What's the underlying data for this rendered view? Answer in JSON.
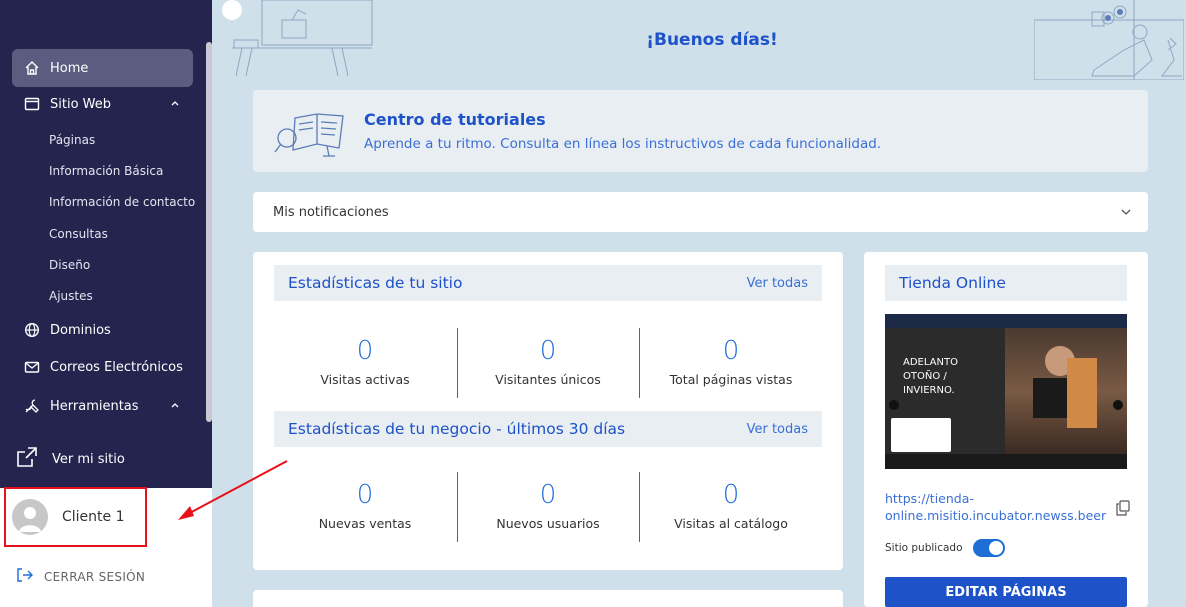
{
  "sidebar": {
    "items": [
      {
        "label": "Home",
        "icon": "home-icon"
      },
      {
        "label": "Sitio Web",
        "icon": "browser-window-icon"
      },
      {
        "label": "Dominios",
        "icon": "globe-icon"
      },
      {
        "label": "Correos Electrónicos",
        "icon": "envelope-icon"
      },
      {
        "label": "Herramientas",
        "icon": "tools-icon"
      }
    ],
    "subitems": [
      "Páginas",
      "Información Básica",
      "Información de contacto",
      "Consultas",
      "Diseño",
      "Ajustes"
    ],
    "view_site": "Ver mi sitio",
    "user_name": "Cliente 1",
    "logout": "CERRAR SESIÓN"
  },
  "greeting": "¡Buenos días!",
  "tutorials": {
    "title": "Centro de tutoriales",
    "description": "Aprende a tu ritmo. Consulta en línea los instructivos de cada funcionalidad."
  },
  "notifications": {
    "label": "Mis notificaciones"
  },
  "site_stats": {
    "title": "Estadísticas de tu sitio",
    "more": "Ver todas",
    "items": [
      {
        "value": "0",
        "label": "Visitas activas"
      },
      {
        "value": "0",
        "label": "Visitantes únicos"
      },
      {
        "value": "0",
        "label": "Total páginas vistas"
      }
    ]
  },
  "business_stats": {
    "title": "Estadísticas de tu negocio - últimos 30 días",
    "more": "Ver todas",
    "items": [
      {
        "value": "0",
        "label": "Nuevas ventas"
      },
      {
        "value": "0",
        "label": "Nuevos usuarios"
      },
      {
        "value": "0",
        "label": "Visitas al catálogo"
      }
    ]
  },
  "store": {
    "title": "Tienda Online",
    "banner_text": [
      "ADELANTO",
      "OTOÑO /",
      "INVIERNO."
    ],
    "url": "https://tienda-online.misitio.incubator.newss.beer",
    "published_label": "Sitio publicado",
    "edit_button": "EDITAR PÁGINAS"
  },
  "colors": {
    "accent": "#1d52c9",
    "sidebar": "#24244f",
    "highlight": "#e8101a"
  }
}
